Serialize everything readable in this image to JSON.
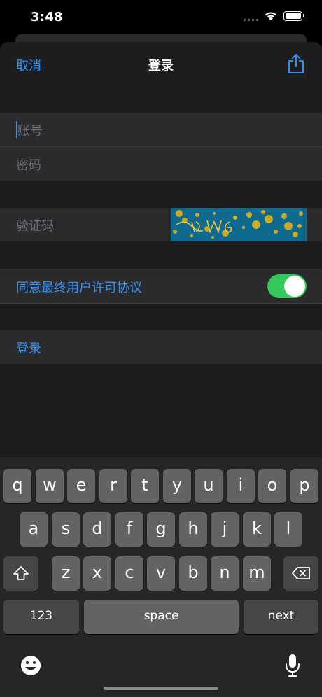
{
  "status": {
    "time": "3:48"
  },
  "nav": {
    "cancel": "取消",
    "title": "登录",
    "share_icon": "share-icon"
  },
  "form": {
    "account_placeholder": "账号",
    "password_placeholder": "密码",
    "captcha_placeholder": "验证码",
    "agreement_label": "同意最终用户许可协议",
    "agreement_on": true,
    "login_label": "登录"
  },
  "keyboard": {
    "row1": [
      "q",
      "w",
      "e",
      "r",
      "t",
      "y",
      "u",
      "i",
      "o",
      "p"
    ],
    "row2": [
      "a",
      "s",
      "d",
      "f",
      "g",
      "h",
      "j",
      "k",
      "l"
    ],
    "row3": [
      "z",
      "x",
      "c",
      "v",
      "b",
      "n",
      "m"
    ],
    "numbers": "123",
    "space": "space",
    "next": "next"
  },
  "colors": {
    "accent": "#3390f2",
    "toggle_on": "#34c759",
    "background": "#1c1c1e"
  }
}
